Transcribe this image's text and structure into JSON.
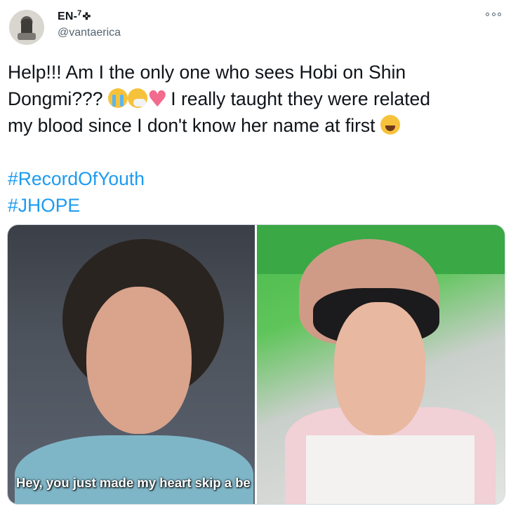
{
  "author": {
    "display_name": "EN-",
    "name_superscript": "7",
    "name_symbol": "✜",
    "handle": "@vantaerica",
    "avatar_icon": "profile-avatar"
  },
  "menu": {
    "more_icon": "more-options-icon"
  },
  "tweet": {
    "line1": "Help!!! Am I the only one who sees Hobi on Shin",
    "line2_prefix": "Dongmi??? ",
    "line2_suffix": " I really taught they were related",
    "line3": "my blood since I don't know her name at first ",
    "emojis": [
      "loudly-crying-face-emoji",
      "sneezing-face-emoji",
      "growing-heart-emoji",
      "face-with-tears-of-joy-emoji"
    ],
    "hashtags": [
      "#RecordOfYouth",
      "#JHOPE"
    ]
  },
  "media": {
    "left_photo_subtitle": "Hey, you just made my heart skip a be",
    "colors": {
      "link": "#1d9bf0",
      "border": "#cfd9de",
      "muted": "#536471"
    }
  }
}
